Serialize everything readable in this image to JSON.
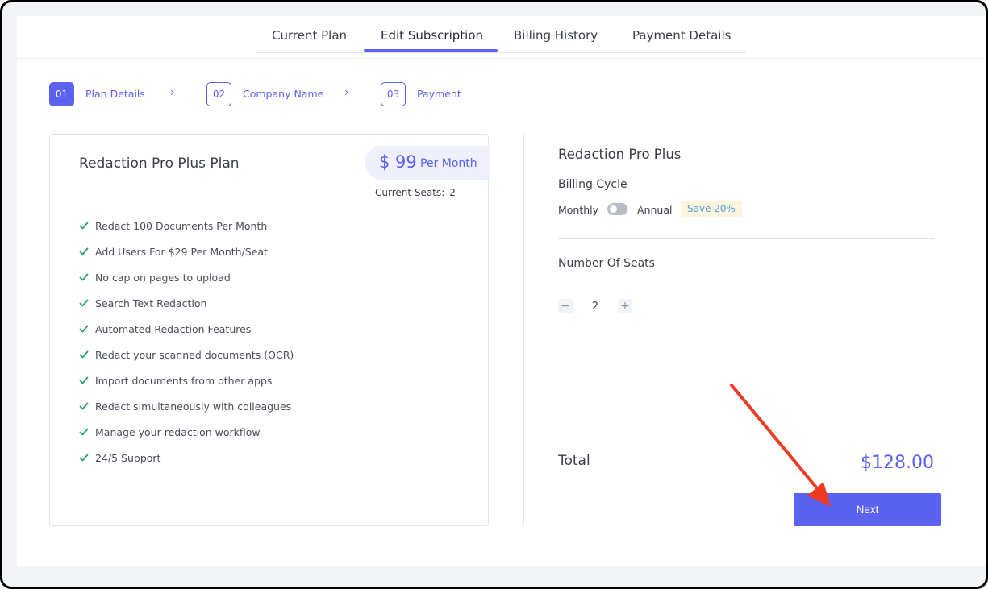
{
  "tabs": [
    {
      "label": "Current Plan"
    },
    {
      "label": "Edit Subscription"
    },
    {
      "label": "Billing History"
    },
    {
      "label": "Payment Details"
    }
  ],
  "active_tab": "Edit Subscription",
  "steps": [
    {
      "number": "01",
      "label": "Plan Details",
      "active": true
    },
    {
      "number": "02",
      "label": "Company Name",
      "active": false
    },
    {
      "number": "03",
      "label": "Payment",
      "active": false
    }
  ],
  "plan": {
    "title": "Redaction Pro Plus Plan",
    "price": "$ 99",
    "period": "Per Month",
    "current_seats_label": "Current Seats:",
    "current_seats_value": "2",
    "features": [
      "Redact 100 Documents Per Month",
      "Add Users For $29 Per Month/Seat",
      "No cap on pages to upload",
      "Search Text Redaction",
      "Automated Redaction Features",
      "Redact your scanned documents (OCR)",
      "Import documents from other apps",
      "Redact simultaneously with colleagues",
      "Manage your redaction workflow",
      "24/5 Support"
    ]
  },
  "summary": {
    "title": "Redaction Pro Plus",
    "billing_cycle_label": "Billing Cycle",
    "monthly_label": "Monthly",
    "annual_label": "Annual",
    "save_badge": "Save 20%",
    "billing_toggle_on": false,
    "seats_label": "Number Of Seats",
    "seats_value": "2",
    "decrement_symbol": "−",
    "increment_symbol": "+",
    "total_label": "Total",
    "total_amount": "$128.00",
    "next_label": "Next"
  },
  "colors": {
    "accent": "#5b62f0",
    "check": "#2ca06b",
    "annotation_arrow": "#f03a23"
  }
}
